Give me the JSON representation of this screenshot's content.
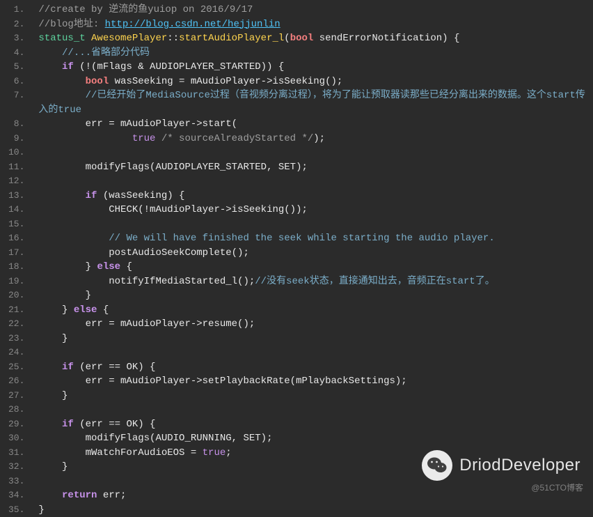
{
  "lines": [
    {
      "n": "1.",
      "segs": [
        {
          "cls": "c-comment",
          "t": "//create by 逆流的鱼yuiop on 2016/9/17"
        }
      ]
    },
    {
      "n": "2.",
      "segs": [
        {
          "cls": "c-comment",
          "t": "//blog地址: "
        },
        {
          "cls": "c-comment-url",
          "t": "http://blog.csdn.net/hejjunlin"
        }
      ]
    },
    {
      "n": "3.",
      "segs": [
        {
          "cls": "c-type",
          "t": "status_t "
        },
        {
          "cls": "c-class",
          "t": "AwesomePlayer"
        },
        {
          "cls": "c-op",
          "t": "::"
        },
        {
          "cls": "c-fn",
          "t": "startAudioPlayer_l"
        },
        {
          "cls": "c-op",
          "t": "("
        },
        {
          "cls": "c-bool",
          "t": "bool"
        },
        {
          "cls": "c-op",
          "t": " sendErrorNotification) {"
        }
      ]
    },
    {
      "n": "4.",
      "segs": [
        {
          "cls": "c-op",
          "t": "    "
        },
        {
          "cls": "c-chinese-comment",
          "t": "//...省略部分代码"
        }
      ]
    },
    {
      "n": "5.",
      "segs": [
        {
          "cls": "c-op",
          "t": "    "
        },
        {
          "cls": "c-keyword",
          "t": "if"
        },
        {
          "cls": "c-op",
          "t": " (!(mFlags & AUDIOPLAYER_STARTED)) {"
        }
      ]
    },
    {
      "n": "6.",
      "segs": [
        {
          "cls": "c-op",
          "t": "        "
        },
        {
          "cls": "c-bool",
          "t": "bool"
        },
        {
          "cls": "c-op",
          "t": " wasSeeking = mAudioPlayer->isSeeking();"
        }
      ]
    },
    {
      "n": "7.",
      "wrap": true,
      "segs": [
        {
          "cls": "c-op",
          "t": "        "
        },
        {
          "cls": "c-chinese-comment",
          "t": "//已经开始了MediaSource过程（音视频分离过程），将为了能让预取器读那些已经分离出来的数据。这个start传入的true"
        }
      ]
    },
    {
      "n": "8.",
      "segs": [
        {
          "cls": "c-op",
          "t": "        err = mAudioPlayer->start("
        }
      ]
    },
    {
      "n": "9.",
      "segs": [
        {
          "cls": "c-op",
          "t": "                "
        },
        {
          "cls": "c-boolean",
          "t": "true"
        },
        {
          "cls": "c-op",
          "t": " "
        },
        {
          "cls": "c-comment",
          "t": "/* sourceAlreadyStarted */"
        },
        {
          "cls": "c-op",
          "t": ");"
        }
      ]
    },
    {
      "n": "10.",
      "segs": [
        {
          "cls": "c-op",
          "t": ""
        }
      ]
    },
    {
      "n": "11.",
      "segs": [
        {
          "cls": "c-op",
          "t": "        modifyFlags(AUDIOPLAYER_STARTED, SET);"
        }
      ]
    },
    {
      "n": "12.",
      "segs": [
        {
          "cls": "c-op",
          "t": ""
        }
      ]
    },
    {
      "n": "13.",
      "segs": [
        {
          "cls": "c-op",
          "t": "        "
        },
        {
          "cls": "c-keyword",
          "t": "if"
        },
        {
          "cls": "c-op",
          "t": " (wasSeeking) {"
        }
      ]
    },
    {
      "n": "14.",
      "segs": [
        {
          "cls": "c-op",
          "t": "            CHECK(!mAudioPlayer->isSeeking());"
        }
      ]
    },
    {
      "n": "15.",
      "segs": [
        {
          "cls": "c-op",
          "t": ""
        }
      ]
    },
    {
      "n": "16.",
      "segs": [
        {
          "cls": "c-op",
          "t": "            "
        },
        {
          "cls": "c-chinese-comment",
          "t": "// We will have finished the seek while starting the audio player."
        }
      ]
    },
    {
      "n": "17.",
      "segs": [
        {
          "cls": "c-op",
          "t": "            postAudioSeekComplete();"
        }
      ]
    },
    {
      "n": "18.",
      "segs": [
        {
          "cls": "c-op",
          "t": "        } "
        },
        {
          "cls": "c-keyword",
          "t": "else"
        },
        {
          "cls": "c-op",
          "t": " {"
        }
      ]
    },
    {
      "n": "19.",
      "segs": [
        {
          "cls": "c-op",
          "t": "            notifyIfMediaStarted_l();"
        },
        {
          "cls": "c-chinese-comment",
          "t": "//没有seek状态，直接通知出去，音频正在start了。"
        }
      ]
    },
    {
      "n": "20.",
      "segs": [
        {
          "cls": "c-op",
          "t": "        }"
        }
      ]
    },
    {
      "n": "21.",
      "segs": [
        {
          "cls": "c-op",
          "t": "    } "
        },
        {
          "cls": "c-keyword",
          "t": "else"
        },
        {
          "cls": "c-op",
          "t": " {"
        }
      ]
    },
    {
      "n": "22.",
      "segs": [
        {
          "cls": "c-op",
          "t": "        err = mAudioPlayer->resume();"
        }
      ]
    },
    {
      "n": "23.",
      "segs": [
        {
          "cls": "c-op",
          "t": "    }"
        }
      ]
    },
    {
      "n": "24.",
      "segs": [
        {
          "cls": "c-op",
          "t": ""
        }
      ]
    },
    {
      "n": "25.",
      "segs": [
        {
          "cls": "c-op",
          "t": "    "
        },
        {
          "cls": "c-keyword",
          "t": "if"
        },
        {
          "cls": "c-op",
          "t": " (err == OK) {"
        }
      ]
    },
    {
      "n": "26.",
      "segs": [
        {
          "cls": "c-op",
          "t": "        err = mAudioPlayer->setPlaybackRate(mPlaybackSettings);"
        }
      ]
    },
    {
      "n": "27.",
      "segs": [
        {
          "cls": "c-op",
          "t": "    }"
        }
      ]
    },
    {
      "n": "28.",
      "segs": [
        {
          "cls": "c-op",
          "t": ""
        }
      ]
    },
    {
      "n": "29.",
      "segs": [
        {
          "cls": "c-op",
          "t": "    "
        },
        {
          "cls": "c-keyword",
          "t": "if"
        },
        {
          "cls": "c-op",
          "t": " (err == OK) {"
        }
      ]
    },
    {
      "n": "30.",
      "segs": [
        {
          "cls": "c-op",
          "t": "        modifyFlags(AUDIO_RUNNING, SET);"
        }
      ]
    },
    {
      "n": "31.",
      "segs": [
        {
          "cls": "c-op",
          "t": "        mWatchForAudioEOS = "
        },
        {
          "cls": "c-boolean",
          "t": "true"
        },
        {
          "cls": "c-op",
          "t": ";"
        }
      ]
    },
    {
      "n": "32.",
      "segs": [
        {
          "cls": "c-op",
          "t": "    }"
        }
      ]
    },
    {
      "n": "33.",
      "segs": [
        {
          "cls": "c-op",
          "t": ""
        }
      ]
    },
    {
      "n": "34.",
      "segs": [
        {
          "cls": "c-op",
          "t": "    "
        },
        {
          "cls": "c-keyword",
          "t": "return"
        },
        {
          "cls": "c-op",
          "t": " err;"
        }
      ]
    },
    {
      "n": "35.",
      "segs": [
        {
          "cls": "c-op",
          "t": "}"
        }
      ]
    }
  ],
  "watermark": {
    "text": "DriodDeveloper",
    "sub": "@51CTO博客"
  }
}
